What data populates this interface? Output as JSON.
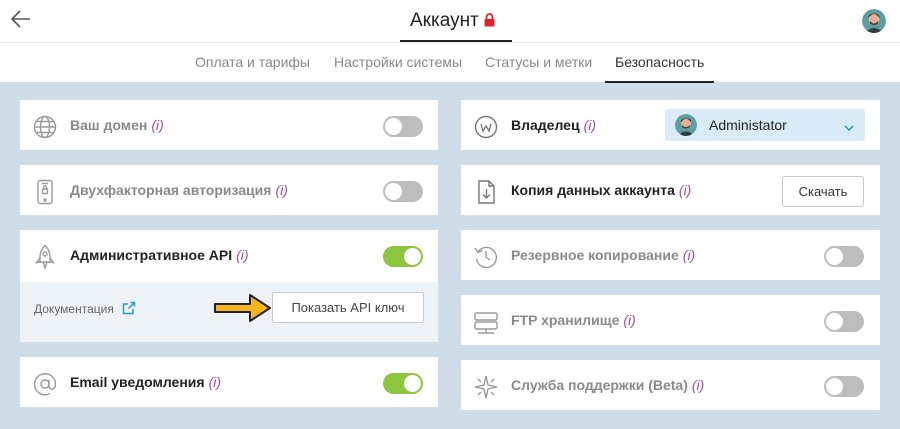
{
  "header": {
    "title": "Аккаунт"
  },
  "tabs": [
    {
      "label": "Оплата и тарифы"
    },
    {
      "label": "Настройки системы"
    },
    {
      "label": "Статусы и метки"
    },
    {
      "label": "Безопасность"
    }
  ],
  "active_tab": "Безопасность",
  "info_marker": "(i)",
  "left": {
    "domain": {
      "label": "Ваш домен",
      "enabled": false,
      "icon": "globe-icon"
    },
    "two_factor": {
      "label": "Двухфакторная авторизация",
      "enabled": false,
      "icon": "phone-icon"
    },
    "admin_api": {
      "label": "Административное API",
      "enabled": true,
      "icon": "rocket-icon",
      "doc_label": "Документация",
      "show_key_label": "Показать API ключ"
    },
    "email": {
      "label": "Email уведомления",
      "enabled": true,
      "icon": "at-icon"
    }
  },
  "right": {
    "owner": {
      "label": "Владелец",
      "value": "Administator",
      "icon": "owner-icon"
    },
    "export": {
      "label": "Копия данных аккаунта",
      "button": "Скачать",
      "icon": "download-icon"
    },
    "backup": {
      "label": "Резервное копирование",
      "enabled": false,
      "icon": "history-icon"
    },
    "ftp": {
      "label": "FTP хранилище",
      "enabled": false,
      "icon": "server-icon"
    },
    "support": {
      "label": "Служба поддержки (Beta)",
      "enabled": false,
      "icon": "sparkle-icon"
    }
  },
  "colors": {
    "background": "#cfdde8",
    "toggle_on": "#8cc63f",
    "toggle_off": "#bdbdbd",
    "info": "#a24ca8",
    "lock": "#e0242c",
    "arrow": "#f5b51c",
    "select_bg": "#d9ecf8"
  }
}
